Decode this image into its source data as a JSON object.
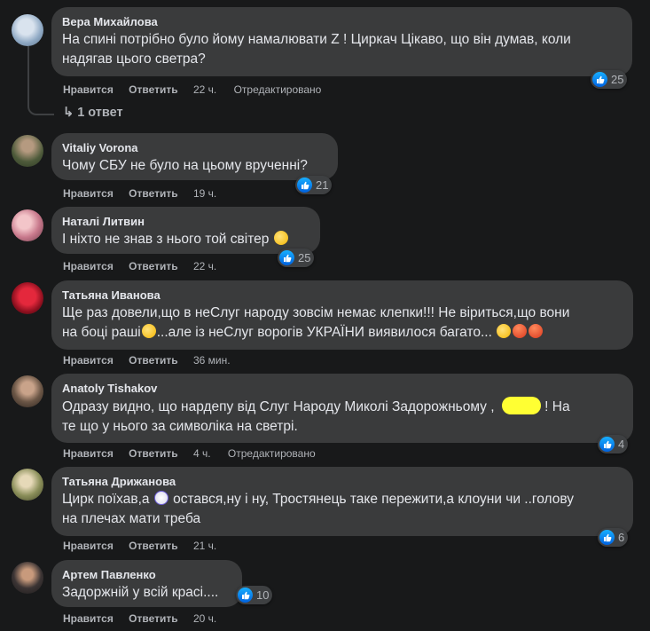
{
  "labels": {
    "like": "Нравится",
    "reply": "Ответить",
    "edited": "Отредактировано"
  },
  "comments": [
    {
      "author": "Вера Михайлова",
      "line1": "На спині потрібно було йому намалювати Z ! Циркач Цікаво, що він думав, коли",
      "line2": "надягав цього светра?",
      "time": "22 ч.",
      "reactions": "25"
    },
    {
      "author": "Vitaliy Vorona",
      "line1": "Чому СБУ не було на цьому врученні?",
      "time": "19 ч.",
      "reactions": "21"
    },
    {
      "author": "Наталі Литвин",
      "line1": "І ніхто не знав з нього той світер",
      "time": "22 ч.",
      "reactions": "25"
    },
    {
      "author": "Татьяна Иванова",
      "line1": "Ще раз довели,що в неСлуг народу зовсім немає клепки!!! Не віриться,що вони",
      "line2a": "на боці раші",
      "line2b": "...але із неСлуг ворогів УКРАЇНИ виявилося багато...",
      "time": "36 мин."
    },
    {
      "author": "Anatoly Tishakov",
      "line1a": "Одразу видно, що нардепу від Слуг Народу Миколі Задорожньому ,",
      "line1b": "! На",
      "line2": "те що у нього за символіка на светрі.",
      "time": "4 ч.",
      "reactions": "4"
    },
    {
      "author": "Татьяна Дрижанова",
      "line1a": "Цирк поїхав,а",
      "line1b": "остався,ну і ну, Тростянець таке пережити,а клоуни чи ..голову",
      "line2": "на плечах мати треба",
      "time": "21 ч.",
      "reactions": "6"
    },
    {
      "author": "Артем Павленко",
      "line1": "Задоржній у всій красі....",
      "time": "20 ч.",
      "reactions": "10"
    }
  ],
  "replies": {
    "count_label": "1 ответ"
  }
}
